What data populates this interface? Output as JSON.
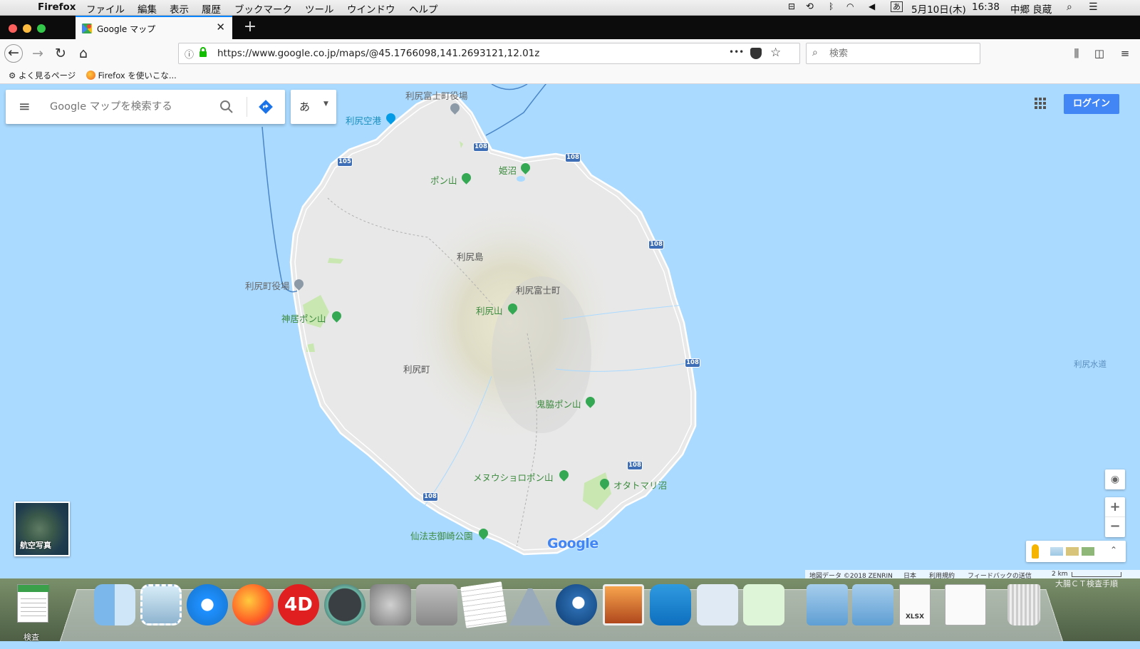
{
  "menubar": {
    "app": "Firefox",
    "items": [
      "ファイル",
      "編集",
      "表示",
      "履歴",
      "ブックマーク",
      "ツール",
      "ウインドウ",
      "ヘルプ"
    ],
    "ime": "あ",
    "date": "5月10日(木)",
    "time": "16:38",
    "user": "中郷 良蔵"
  },
  "tab": {
    "title": "Google マップ",
    "close": "✕",
    "new": "+"
  },
  "navbar": {
    "url": "https://www.google.co.jp/maps/@45.1766098,141.2693121,12.01z",
    "search_placeholder": "検索",
    "more": "•••"
  },
  "bookmarks": [
    "よく見るページ",
    "Firefox を使いこな..."
  ],
  "maps": {
    "search_placeholder": "Google マップを検索する",
    "lang": "あ",
    "login": "ログイン",
    "aerial": "航空写真",
    "logo": "Google",
    "footer": {
      "data": "地図データ ©2018 ZENRIN",
      "country": "日本",
      "terms": "利用規約",
      "feedback": "フィードバックの送信",
      "scale": "2 km"
    }
  },
  "map_labels": {
    "rishirifuji_office": "利尻富士町役場",
    "airport": "利尻空港",
    "himenuma": "姫沼",
    "ponyama": "ポン山",
    "island": "利尻島",
    "rishirifuji_town": "利尻富士町",
    "rishiri_mountain": "利尻山",
    "rishiri_office": "利尻町役場",
    "kamui_pon": "神居ポン山",
    "rishiri_town": "利尻町",
    "kiwaki_pon": "鬼脇ポン山",
    "menushoro_pon": "メヌウショロポン山",
    "otatomari": "オタトマリ沼",
    "senposhi": "仙法志御崎公園",
    "channel": "利尻水道"
  },
  "route_numbers": [
    "108",
    "105",
    "108",
    "108",
    "108",
    "108",
    "108"
  ],
  "dock": {
    "label": "検査",
    "xlsx": "XLSX",
    "app4d": "4D",
    "desktop_text": "大腸ＣＴ検査手順"
  },
  "colors": {
    "water": "#aadaff",
    "land": "#e8e8e8",
    "park": "#c9e7b1",
    "accent": "#4285f4",
    "route": "#3e6fb6",
    "ferry": "#4a86c8"
  }
}
